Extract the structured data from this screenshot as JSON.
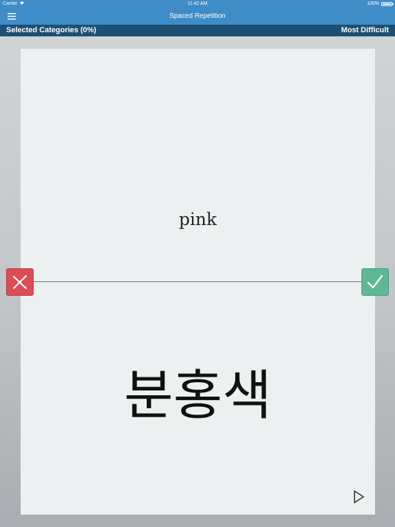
{
  "status_bar": {
    "carrier": "Carrier",
    "wifi_icon": "wifi-icon",
    "time": "11:42 AM",
    "battery": "100%",
    "battery_level": 1.0
  },
  "nav": {
    "title": "Spaced Repetition",
    "menu_icon": "hamburger-menu-icon"
  },
  "category_bar": {
    "selected_categories": "Selected Categories (0%)",
    "sort_mode": "Most Difficult"
  },
  "card": {
    "english": "pink",
    "korean": "분홍색",
    "play_icon": "play-icon"
  },
  "actions": {
    "wrong_icon": "x-icon",
    "correct_icon": "checkmark-icon"
  },
  "colors": {
    "nav_blue": "#3f8dc8",
    "category_bar": "#1b4f74",
    "wrong_red": "#dd4c55",
    "correct_green": "#5fb895",
    "card_bg": "#ecf0f1"
  }
}
